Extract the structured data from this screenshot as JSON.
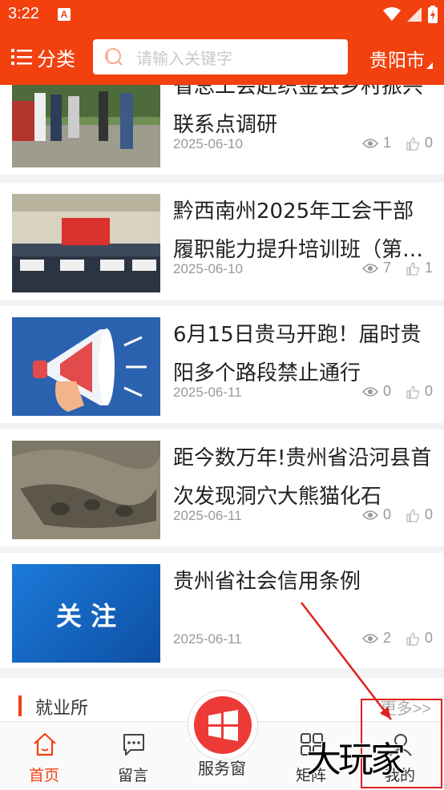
{
  "status_bar": {
    "time": "3:22",
    "notif_icon": "A"
  },
  "header": {
    "category_label": "分类",
    "search_placeholder": "请输入关键字",
    "city": "贵阳市"
  },
  "articles": [
    {
      "title": "省总工会赴织金县乡村振兴联系点调研",
      "date": "2025-06-10",
      "views": "1",
      "likes": "0"
    },
    {
      "title": "黔西南州2025年工会干部履职能力提升培训班（第…",
      "date": "2025-06-10",
      "views": "7",
      "likes": "1"
    },
    {
      "title": "6月15日贵马开跑！届时贵阳多个路段禁止通行",
      "date": "2025-06-11",
      "views": "0",
      "likes": "0"
    },
    {
      "title": "距今数万年!贵州省沿河县首次发现洞穴大熊猫化石",
      "date": "2025-06-11",
      "views": "0",
      "likes": "0"
    },
    {
      "title": "贵州省社会信用条例",
      "date": "2025-06-11",
      "views": "2",
      "likes": "0",
      "thumb_text": "关 注"
    }
  ],
  "section": {
    "title": "就业所",
    "more": "更多>>"
  },
  "nav": {
    "home": "首页",
    "message": "留言",
    "service": "服务窗",
    "matrix": "矩阵",
    "mine": "我的"
  },
  "watermark": "大玩家",
  "colors": {
    "brand": "#f2410f",
    "service": "#ec3a36",
    "annotation": "#e02020"
  }
}
